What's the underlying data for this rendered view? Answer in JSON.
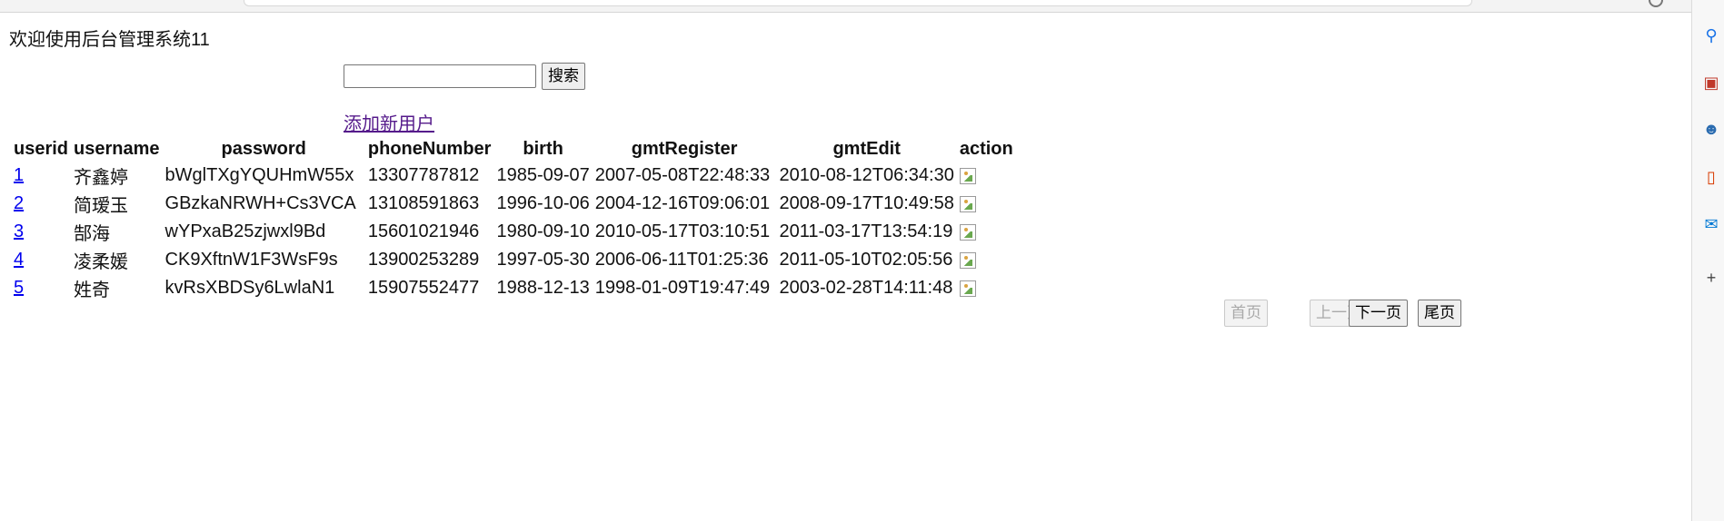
{
  "welcome_text": "欢迎使用后台管理系统11",
  "search": {
    "value": "",
    "placeholder": "",
    "button_label": "搜索"
  },
  "add_user_link": "添加新用户",
  "table": {
    "headers": [
      "userid",
      "username",
      "password",
      "phoneNumber",
      "birth",
      "gmtRegister",
      "gmtEdit",
      "action"
    ],
    "rows": [
      {
        "userid": "1",
        "username": "齐鑫婷",
        "password": "bWglTXgYQUHmW55x",
        "phone": "13307787812",
        "birth": "1985-09-07",
        "gmtRegister": "2007-05-08T22:48:33",
        "gmtEdit": "2010-08-12T06:34:30"
      },
      {
        "userid": "2",
        "username": "简瑷玉",
        "password": "GBzkaNRWH+Cs3VCA",
        "phone": "13108591863",
        "birth": "1996-10-06",
        "gmtRegister": "2004-12-16T09:06:01",
        "gmtEdit": "2008-09-17T10:49:58"
      },
      {
        "userid": "3",
        "username": "郜海",
        "password": "wYPxaB25zjwxl9Bd",
        "phone": "15601021946",
        "birth": "1980-09-10",
        "gmtRegister": "2010-05-17T03:10:51",
        "gmtEdit": "2011-03-17T13:54:19"
      },
      {
        "userid": "4",
        "username": "凌柔媛",
        "password": "CK9XftnW1F3WsF9s",
        "phone": "13900253289",
        "birth": "1997-05-30",
        "gmtRegister": "2006-06-11T01:25:36",
        "gmtEdit": "2011-05-10T02:05:56"
      },
      {
        "userid": "5",
        "username": "姓奇",
        "password": "kvRsXBDSy6LwlaN1",
        "phone": "15907552477",
        "birth": "1988-12-13",
        "gmtRegister": "1998-01-09T19:47:49",
        "gmtEdit": "2003-02-28T14:11:48"
      }
    ]
  },
  "pagination": {
    "first": "首页",
    "prev": "上一页",
    "next": "下一页",
    "last": "尾页"
  },
  "sidebar_icons": [
    "search-icon",
    "briefcase-icon",
    "people-icon",
    "office-icon",
    "outlook-icon",
    "plus-icon"
  ],
  "colors": {
    "link_visited": "#551a8b",
    "link": "#0000ee"
  }
}
